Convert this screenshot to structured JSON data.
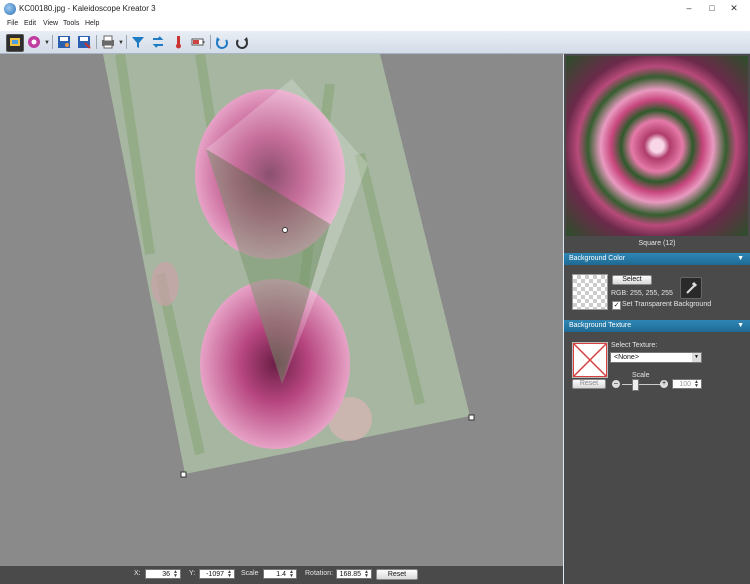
{
  "window": {
    "title": "KC00180.jpg - Kaleidoscope Kreator 3"
  },
  "menu": [
    "File",
    "Edit",
    "View",
    "Tools",
    "Help"
  ],
  "preview": {
    "label": "Square (12)"
  },
  "background_color": {
    "header": "Background Color",
    "select_label": "Select",
    "rgb_text": "RGB: 255, 255, 255",
    "transparent_label": "Set Transparent Background",
    "transparent_checked": true
  },
  "background_texture": {
    "header": "Background Texture",
    "select_texture_label": "Select Texture:",
    "texture_value": "<None>",
    "reset_label": "Reset",
    "scale_label": "Scale",
    "scale_value": "100"
  },
  "bottom": {
    "x_label": "X:",
    "x_value": "36",
    "y_label": "Y:",
    "y_value": "-1097",
    "scale_label": "Scale",
    "scale_value": "1.4",
    "rotation_label": "Rotation:",
    "rotation_value": "168.85",
    "reset_label": "Reset"
  },
  "colors": {
    "accent": "#1e6b94",
    "panel": "#4a4a4a",
    "canvas": "#8a8a8a"
  },
  "icons": [
    "app-icon",
    "minimize-icon",
    "maximize-icon",
    "close-icon",
    "open-image-icon",
    "kaleidoscope-settings-icon",
    "save-image-icon",
    "save-as-icon",
    "print-icon",
    "funnel-icon",
    "swap-arrows-icon",
    "thermometer-icon",
    "battery-icon",
    "undo-icon",
    "redo-icon",
    "eyedropper-icon",
    "chevron-down-icon"
  ]
}
